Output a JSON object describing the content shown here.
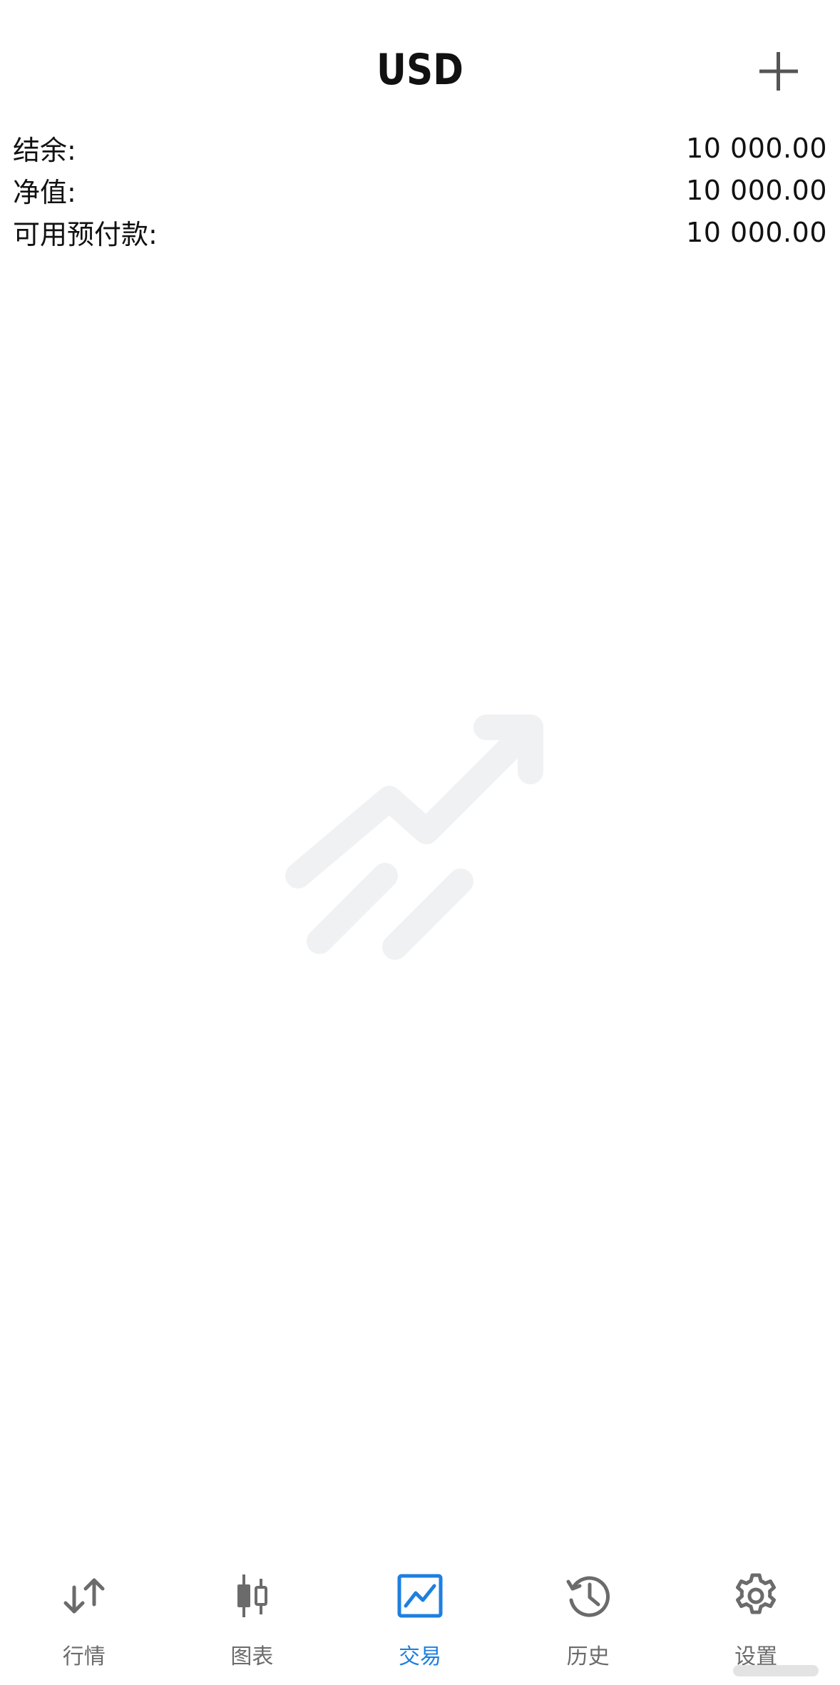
{
  "header": {
    "title": "USD",
    "add_icon": "plus-icon"
  },
  "summary": [
    {
      "label": "结余:",
      "value": "10 000.00"
    },
    {
      "label": "净值:",
      "value": "10 000.00"
    },
    {
      "label": "可用预付款:",
      "value": "10 000.00"
    }
  ],
  "empty_state": {
    "icon": "trade-trend-icon"
  },
  "nav": {
    "active_color": "#1e7fe0",
    "inactive_color": "#6b6b6b",
    "items": [
      {
        "label": "行情",
        "icon": "quotes-arrows-icon",
        "active": false
      },
      {
        "label": "图表",
        "icon": "candlestick-chart-icon",
        "active": false
      },
      {
        "label": "交易",
        "icon": "trade-chart-icon",
        "active": true
      },
      {
        "label": "历史",
        "icon": "history-clock-icon",
        "active": false
      },
      {
        "label": "设置",
        "icon": "settings-gear-icon",
        "active": false
      }
    ]
  }
}
